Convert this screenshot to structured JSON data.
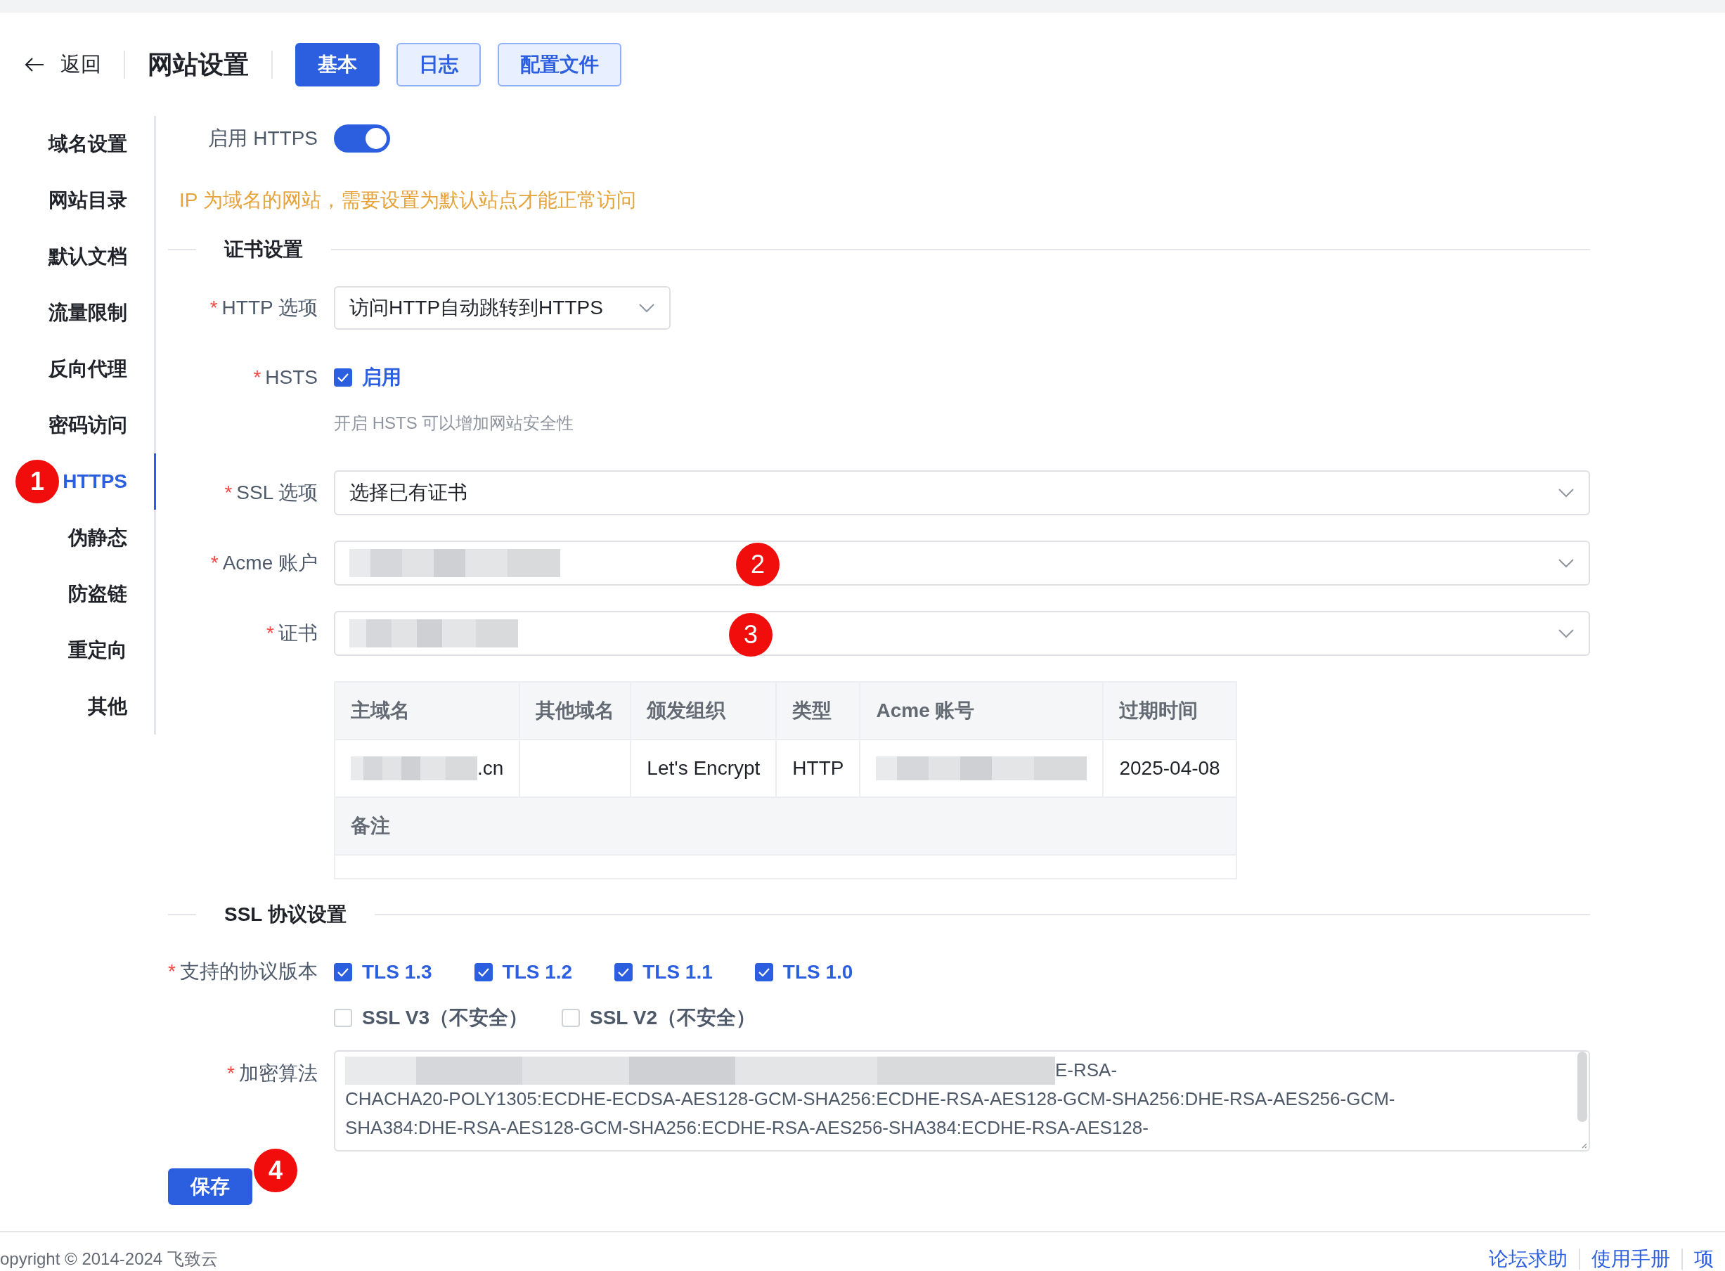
{
  "header": {
    "back": {
      "label": "返回"
    },
    "title": "网站设置",
    "tabs": [
      {
        "label": "基本",
        "selected": true
      },
      {
        "label": "日志",
        "selected": false
      },
      {
        "label": "配置文件",
        "selected": false
      }
    ]
  },
  "sidebar": {
    "items": [
      {
        "label": "域名设置",
        "selected": false
      },
      {
        "label": "网站目录",
        "selected": false
      },
      {
        "label": "默认文档",
        "selected": false
      },
      {
        "label": "流量限制",
        "selected": false
      },
      {
        "label": "反向代理",
        "selected": false
      },
      {
        "label": "密码访问",
        "selected": false
      },
      {
        "label": "HTTPS",
        "selected": true,
        "marker": "1"
      },
      {
        "label": "伪静态",
        "selected": false
      },
      {
        "label": "防盗链",
        "selected": false
      },
      {
        "label": "重定向",
        "selected": false
      },
      {
        "label": "其他",
        "selected": false
      }
    ]
  },
  "https_toggle": {
    "label": "启用 HTTPS",
    "on": true
  },
  "warning": "IP 为域名的网站，需要设置为默认站点才能正常访问",
  "cert_section": {
    "title": "证书设置",
    "http_option": {
      "label": "HTTP 选项",
      "required_mark": "*",
      "value": "访问HTTP自动跳转到HTTPS"
    },
    "hsts": {
      "label": "HSTS",
      "required_mark": "*",
      "checkbox": {
        "label": "启用",
        "checked": true
      },
      "hint": "开启 HSTS 可以增加网站安全性"
    },
    "ssl_option": {
      "label": "SSL 选项",
      "required_mark": "*",
      "value": "选择已有证书"
    },
    "acme_account": {
      "label": "Acme 账户",
      "required_mark": "*",
      "redacted": true,
      "marker": "2"
    },
    "certificate": {
      "label": "证书",
      "required_mark": "*",
      "redacted": true,
      "marker": "3"
    },
    "table": {
      "columns": [
        "主域名",
        "其他域名",
        "颁发组织",
        "类型",
        "Acme 账号",
        "过期时间"
      ],
      "rows": [
        [
          {
            "text": ".cn",
            "redacted": true
          },
          {},
          {
            "text": "Let's Encrypt"
          },
          {
            "text": "HTTP"
          },
          {
            "redacted": true
          },
          {
            "text": "2025-04-08"
          }
        ]
      ],
      "remark_label": "备注"
    }
  },
  "ssl_section": {
    "title": "SSL 协议设置",
    "protocols": {
      "label": "支持的协议版本",
      "required_mark": "*",
      "options": [
        {
          "label": "TLS 1.3",
          "checked": true
        },
        {
          "label": "TLS 1.2",
          "checked": true
        },
        {
          "label": "TLS 1.1",
          "checked": true
        },
        {
          "label": "TLS 1.0",
          "checked": true
        },
        {
          "label": "SSL V3（不安全）",
          "checked": false
        },
        {
          "label": "SSL V2（不安全）",
          "checked": false
        }
      ]
    },
    "cipher": {
      "label": "加密算法",
      "required_mark": "*",
      "redacted": true,
      "lines": [
        "E-RSA-",
        "CHACHA20-POLY1305:ECDHE-ECDSA-AES128-GCM-SHA256:ECDHE-RSA-AES128-GCM-SHA256:DHE-RSA-AES256-GCM-",
        "SHA384:DHE-RSA-AES128-GCM-SHA256:ECDHE-RSA-AES256-SHA384:ECDHE-RSA-AES128-"
      ]
    }
  },
  "save_button": {
    "label": "保存",
    "marker": "4"
  },
  "footer": {
    "copyright": "opyright © 2014-2024 飞致云",
    "links": [
      "论坛求助",
      "使用手册",
      "项"
    ]
  }
}
